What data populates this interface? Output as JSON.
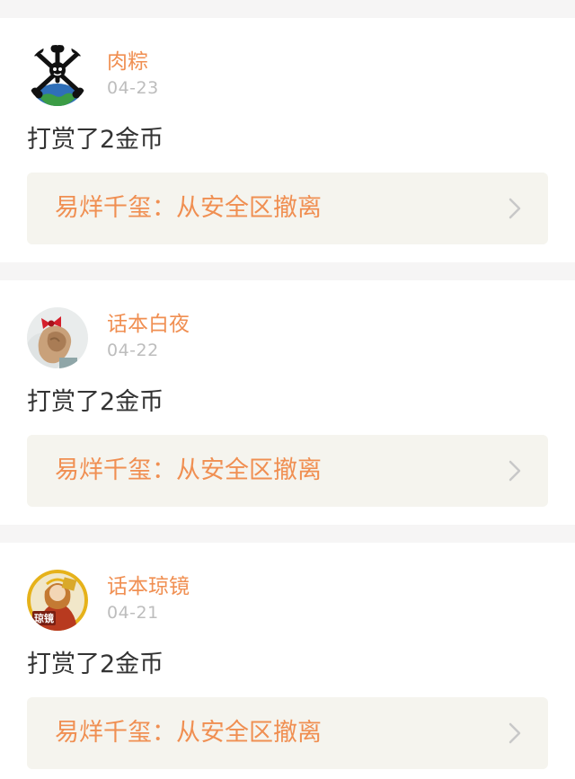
{
  "feed": {
    "items": [
      {
        "username": "肉粽",
        "date": "04-23",
        "action": "打赏了2金币",
        "book_title": "易烊千玺：从安全区撤离",
        "avatar_icon": "bones-globe-avatar"
      },
      {
        "username": "话本白夜",
        "date": "04-22",
        "action": "打赏了2金币",
        "book_title": "易烊千玺：从安全区撤离",
        "avatar_icon": "red-bow-hair-avatar"
      },
      {
        "username": "话本琼镜",
        "date": "04-21",
        "action": "打赏了2金币",
        "book_title": "易烊千玺：从安全区撤离",
        "avatar_icon": "illustrated-character-avatar",
        "avatar_badge": "琼镜"
      }
    ]
  },
  "colors": {
    "accent": "#f08f52",
    "text": "#333333",
    "muted": "#bdbdbd",
    "page_bg": "#f6f5f5",
    "card_bg": "#ffffff",
    "link_box_bg": "#f5f4ee",
    "chevron": "#c8c8c8"
  },
  "icons": {
    "chevron": "chevron-right-icon"
  }
}
